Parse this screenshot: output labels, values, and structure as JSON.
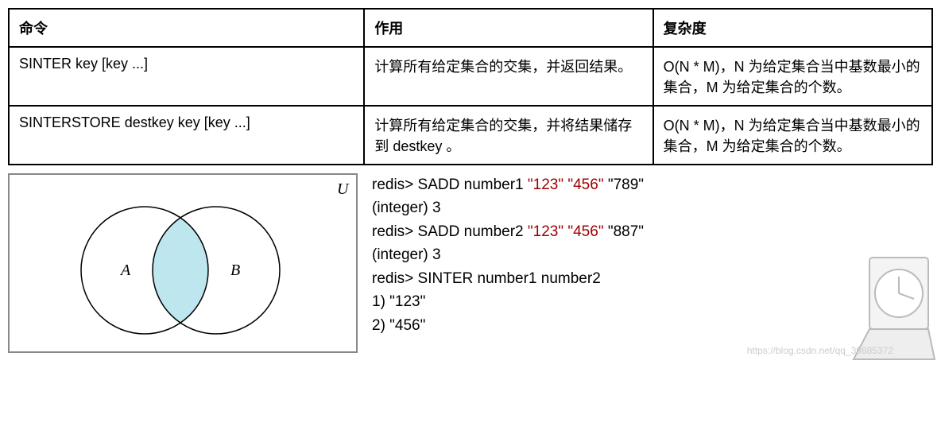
{
  "table": {
    "headers": [
      "命令",
      "作用",
      "复杂度"
    ],
    "rows": [
      {
        "cmd": "SINTER key [key ...]",
        "effect": "计算所有给定集合的交集，并返回结果。",
        "complexity": "O(N * M)，N 为给定集合当中基数最小的集合，M 为给定集合的个数。"
      },
      {
        "cmd": "SINTERSTORE destkey key [key ...]",
        "effect": "计算所有给定集合的交集，并将结果储存到 destkey 。",
        "complexity": "O(N * M)，N 为给定集合当中基数最小的集合，M 为给定集合的个数。"
      }
    ]
  },
  "venn": {
    "U": "U",
    "A": "A",
    "B": "B"
  },
  "code": {
    "l1a": "redis> SADD number1 ",
    "l1b": "\"123\" \"456\"",
    "l1c": " \"789\"",
    "l2": "(integer) 3",
    "l3a": "redis> SADD number2 ",
    "l3b": "\"123\" \"456\"",
    "l3c": " \"887\"",
    "l4": "(integer) 3",
    "l5": "redis> SINTER number1 number2",
    "l6": "1) \"123\"",
    "l7": "2) \"456\""
  },
  "watermark": "https://blog.csdn.net/qq_39885372"
}
